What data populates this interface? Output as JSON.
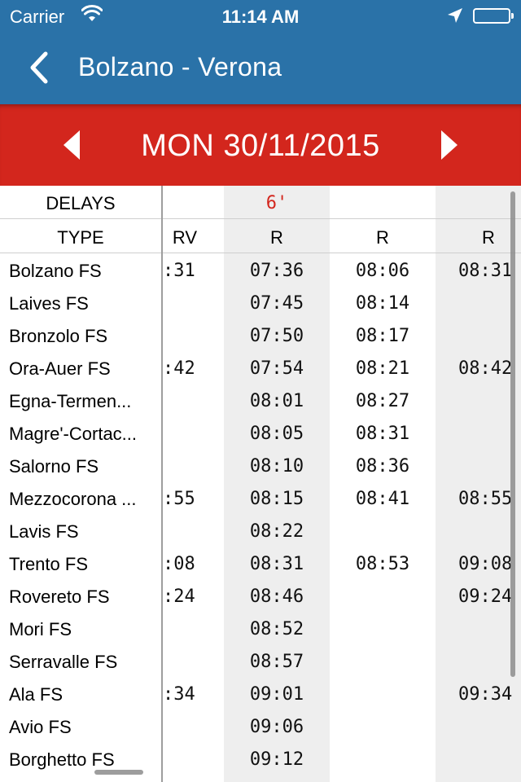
{
  "status": {
    "carrier": "Carrier",
    "time": "11:14 AM"
  },
  "nav": {
    "title": "Bolzano - Verona"
  },
  "date_bar": {
    "date": "MON 30/11/2015"
  },
  "table": {
    "header_delays": "DELAYS",
    "header_type": "TYPE",
    "trains": [
      {
        "type": "RV",
        "delay": ""
      },
      {
        "type": "R",
        "delay": "6'"
      },
      {
        "type": "R",
        "delay": ""
      },
      {
        "type": "R",
        "delay": ""
      }
    ],
    "stops": [
      {
        "name": "Bolzano FS",
        "times": [
          ":31",
          "07:36",
          "08:06",
          "08:31"
        ]
      },
      {
        "name": "Laives FS",
        "times": [
          "",
          "07:45",
          "08:14",
          ""
        ]
      },
      {
        "name": "Bronzolo FS",
        "times": [
          "",
          "07:50",
          "08:17",
          ""
        ]
      },
      {
        "name": "Ora-Auer FS",
        "times": [
          ":42",
          "07:54",
          "08:21",
          "08:42"
        ]
      },
      {
        "name": "Egna-Termen...",
        "times": [
          "",
          "08:01",
          "08:27",
          ""
        ]
      },
      {
        "name": "Magre'-Cortac...",
        "times": [
          "",
          "08:05",
          "08:31",
          ""
        ]
      },
      {
        "name": "Salorno FS",
        "times": [
          "",
          "08:10",
          "08:36",
          ""
        ]
      },
      {
        "name": "Mezzocorona ...",
        "times": [
          ":55",
          "08:15",
          "08:41",
          "08:55"
        ]
      },
      {
        "name": "Lavis FS",
        "times": [
          "",
          "08:22",
          "",
          ""
        ]
      },
      {
        "name": "Trento FS",
        "times": [
          ":08",
          "08:31",
          "08:53",
          "09:08"
        ]
      },
      {
        "name": "Rovereto FS",
        "times": [
          ":24",
          "08:46",
          "",
          "09:24"
        ]
      },
      {
        "name": "Mori FS",
        "times": [
          "",
          "08:52",
          "",
          ""
        ]
      },
      {
        "name": "Serravalle FS",
        "times": [
          "",
          "08:57",
          "",
          ""
        ]
      },
      {
        "name": "Ala FS",
        "times": [
          ":34",
          "09:01",
          "",
          "09:34"
        ]
      },
      {
        "name": "Avio FS",
        "times": [
          "",
          "09:06",
          "",
          ""
        ]
      },
      {
        "name": "Borghetto FS",
        "times": [
          "",
          "09:12",
          "",
          ""
        ]
      }
    ]
  },
  "icons": {
    "back": "chevron-left-icon",
    "prev": "triangle-left-icon",
    "next": "triangle-right-icon",
    "wifi": "wifi-icon",
    "location": "location-arrow-icon",
    "battery": "battery-icon"
  },
  "colors": {
    "nav": "#2a72a8",
    "date_bar": "#d3261d",
    "delay_text": "#d3261d",
    "alt_column": "#eeeeee"
  }
}
